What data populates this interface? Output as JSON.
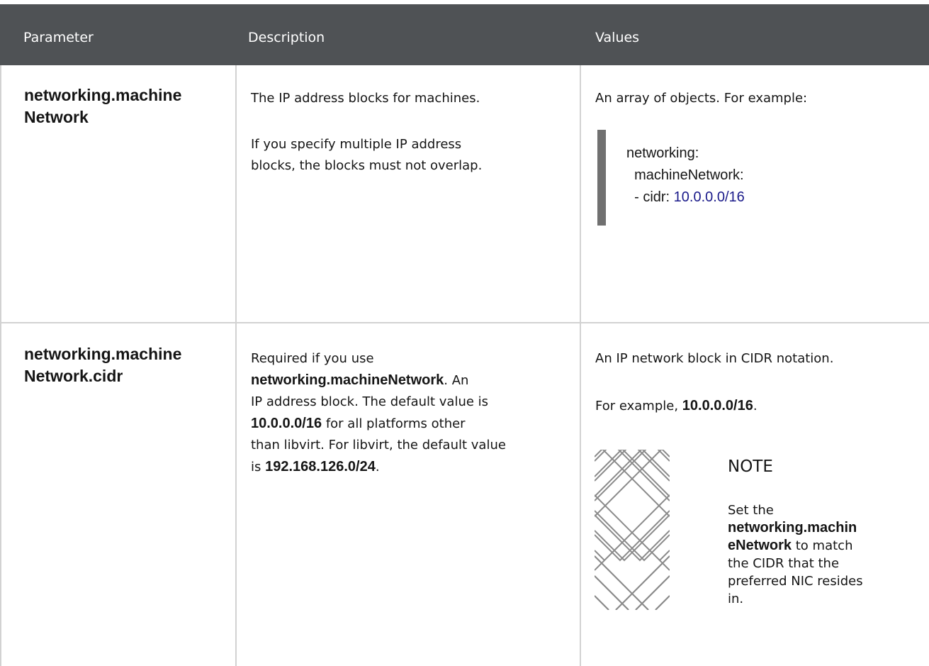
{
  "table": {
    "headers": [
      "Parameter",
      "Description",
      "Values"
    ],
    "rows": [
      {
        "parameter_line1": "networking.machine",
        "parameter_line2": "Network",
        "description_p1": "The IP address blocks for machines.",
        "description_p2_line1": "If you specify multiple IP address",
        "description_p2_line2": "blocks, the blocks must not overlap.",
        "values_intro": "An array of objects. For example:",
        "code": {
          "line1": "networking:",
          "line2": "  machineNetwork:",
          "line3_prefix": "  - cidr: ",
          "line3_value": "10.0.0.0/16"
        }
      },
      {
        "parameter_line1": "networking.machine",
        "parameter_line2": "Network.cidr",
        "description": {
          "l1": "Required if you use",
          "l2_bold": "networking.machineNetwork",
          "l2_rest": ". An",
          "l3": "IP address block. The default value is",
          "l4_bold": "10.0.0.0/16",
          "l4_rest": " for all platforms other",
          "l5": "than libvirt. For libvirt, the default value",
          "l6_pre": "is ",
          "l6_bold": "192.168.126.0/24",
          "l6_rest": "."
        },
        "values": {
          "intro": "An IP network block in CIDR notation.",
          "example_pre": "For example, ",
          "example_bold": "10.0.0.0/16",
          "example_post": "."
        },
        "note": {
          "icon": "note-pattern-icon",
          "title": "NOTE",
          "l1": "Set the",
          "l2_bold": "networking.machin",
          "l3_bold": "eNetwork",
          "l3_rest": " to match",
          "l4": "the CIDR that the",
          "l5": "preferred NIC resides",
          "l6": "in."
        }
      }
    ]
  },
  "colors": {
    "header_bg": "#4f5255",
    "header_text": "#ffffff",
    "border": "#d2d2d2",
    "code_bar": "#707070",
    "code_number": "#1a1a8a"
  }
}
